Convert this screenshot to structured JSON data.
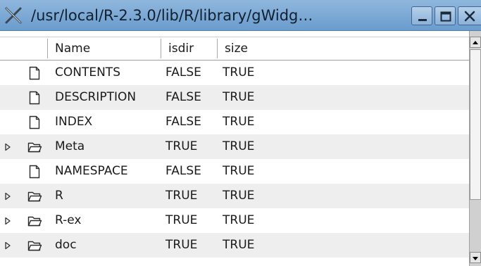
{
  "window": {
    "title": "/usr/local/R-2.3.0/lib/R/library/gWidg…"
  },
  "titlebar": {
    "icon": "x-app-icon",
    "buttons": [
      "minimize-icon",
      "maximize-icon",
      "close-icon"
    ]
  },
  "table": {
    "columns": [
      "Name",
      "isdir",
      "size"
    ],
    "rows": [
      {
        "name": "CONTENTS",
        "isdir": "FALSE",
        "size": "TRUE",
        "icon": "file-icon",
        "expandable": false
      },
      {
        "name": "DESCRIPTION",
        "isdir": "FALSE",
        "size": "TRUE",
        "icon": "file-icon",
        "expandable": false
      },
      {
        "name": "INDEX",
        "isdir": "FALSE",
        "size": "TRUE",
        "icon": "file-icon",
        "expandable": false
      },
      {
        "name": "Meta",
        "isdir": "TRUE",
        "size": "TRUE",
        "icon": "folder-icon",
        "expandable": true
      },
      {
        "name": "NAMESPACE",
        "isdir": "FALSE",
        "size": "TRUE",
        "icon": "file-icon",
        "expandable": false
      },
      {
        "name": "R",
        "isdir": "TRUE",
        "size": "TRUE",
        "icon": "folder-icon",
        "expandable": true
      },
      {
        "name": "R-ex",
        "isdir": "TRUE",
        "size": "TRUE",
        "icon": "folder-icon",
        "expandable": true
      },
      {
        "name": "doc",
        "isdir": "TRUE",
        "size": "TRUE",
        "icon": "folder-icon",
        "expandable": true
      }
    ]
  },
  "colors": {
    "titlebar": "#7aa7d4",
    "row_alt": "#eeeeee",
    "text": "#1a1a1a"
  }
}
